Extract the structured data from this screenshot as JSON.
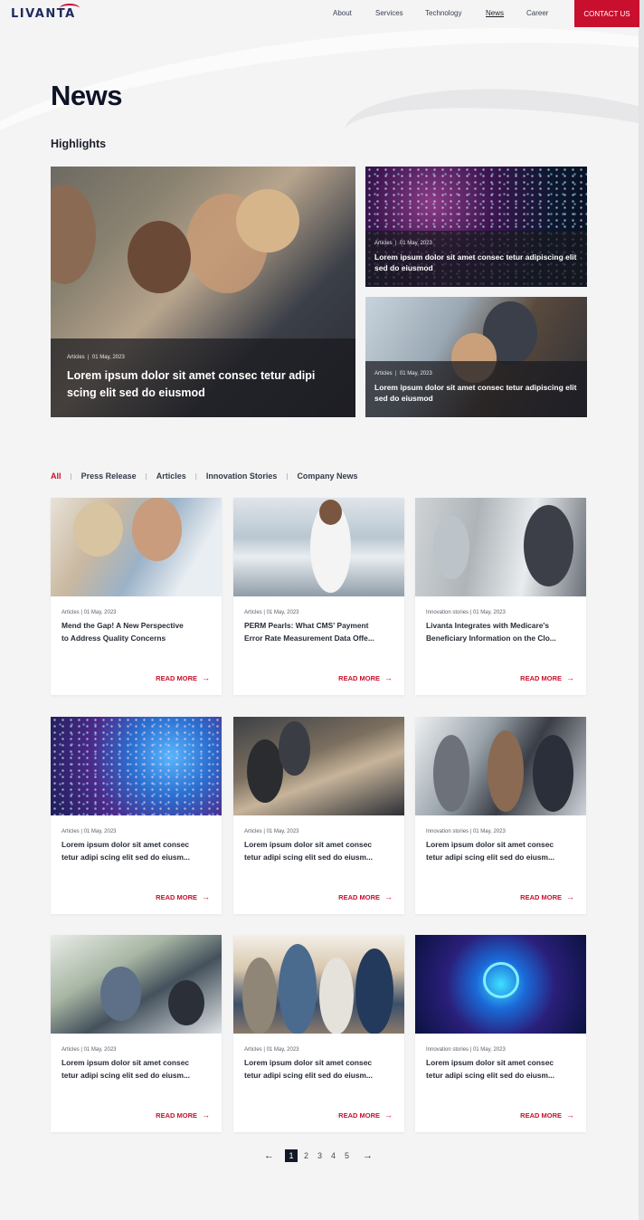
{
  "header": {
    "logo": "LIVANTA",
    "nav": [
      "About",
      "Services",
      "Technology",
      "News",
      "Career"
    ],
    "active_nav": "News",
    "contact_label": "CONTACT US",
    "accent_color": "#c8102e"
  },
  "page": {
    "title": "News",
    "highlights_title": "Highlights"
  },
  "highlights": [
    {
      "category": "Articles",
      "date": "01 May, 2023",
      "headline": "Lorem ipsum dolor sit amet consec tetur adipi scing elit sed do eiusmod"
    },
    {
      "category": "Articles",
      "date": "01 May, 2023",
      "headline": "Lorem ipsum dolor sit amet consec tetur adipiscing elit sed do eiusmod"
    },
    {
      "category": "Articles",
      "date": "01 May, 2023",
      "headline": "Lorem ipsum dolor sit amet consec tetur adipiscing elit sed do eiusmod"
    }
  ],
  "filters": [
    "All",
    "Press Release",
    "Articles",
    "Innovation Stories",
    "Company News"
  ],
  "active_filter": "All",
  "cards": [
    {
      "category": "Articles",
      "date": "01 May, 2023",
      "title_line1": "Mend the Gap! A New Perspective",
      "title_line2": "to Address Quality Concerns",
      "cta": "READ MORE"
    },
    {
      "category": "Articles",
      "date": "01 May, 2023",
      "title_line1": "PERM Pearls: What CMS' Payment",
      "title_line2": "Error Rate Measurement Data Offe...",
      "cta": "READ MORE"
    },
    {
      "category": "Innovation stories",
      "date": "01 May, 2023",
      "title_line1": "Livanta Integrates with Medicare's",
      "title_line2": "Beneficiary Information on the Clo...",
      "cta": "READ MORE"
    },
    {
      "category": "Articles",
      "date": "01 May, 2023",
      "title_line1": "Lorem ipsum dolor sit amet consec",
      "title_line2": "tetur adipi scing elit sed do eiusm...",
      "cta": "READ MORE"
    },
    {
      "category": "Articles",
      "date": "01 May, 2023",
      "title_line1": "Lorem ipsum dolor sit amet consec",
      "title_line2": "tetur adipi scing elit sed do eiusm...",
      "cta": "READ MORE"
    },
    {
      "category": "Innovation stories",
      "date": "01 May, 2023",
      "title_line1": "Lorem ipsum dolor sit amet consec",
      "title_line2": "tetur adipi scing elit sed do eiusm...",
      "cta": "READ MORE"
    },
    {
      "category": "Articles",
      "date": "01 May, 2023",
      "title_line1": "Lorem ipsum dolor sit amet consec",
      "title_line2": "tetur adipi scing elit sed do eiusm...",
      "cta": "READ MORE"
    },
    {
      "category": "Articles",
      "date": "01 May, 2023",
      "title_line1": "Lorem ipsum dolor sit amet consec",
      "title_line2": "tetur adipi scing elit sed do eiusm...",
      "cta": "READ MORE"
    },
    {
      "category": "Innovation stories",
      "date": "01 May, 2023",
      "title_line1": "Lorem ipsum dolor sit amet consec",
      "title_line2": "tetur adipi scing elit sed do eiusm...",
      "cta": "READ MORE"
    }
  ],
  "pagination": {
    "prev_icon": "arrow-left-icon",
    "next_icon": "arrow-right-icon",
    "pages": [
      "1",
      "2",
      "3",
      "4",
      "5"
    ],
    "current": "1"
  },
  "icons": {
    "read_more_arrow": "arrow-right-icon"
  }
}
